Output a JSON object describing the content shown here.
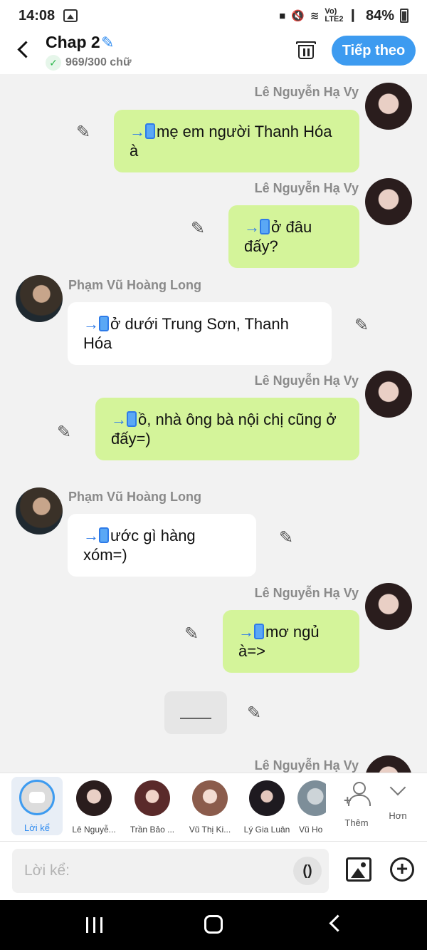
{
  "status_bar": {
    "time": "14:08",
    "network": "Vo) LTE2",
    "battery": "84%"
  },
  "header": {
    "title": "Chap 2",
    "word_count": "969/300 chữ",
    "next_label": "Tiếp theo",
    "accent_color": "#3d9bf0"
  },
  "messages": [
    {
      "sender": "Lê Nguyễn Hạ Vy",
      "text": "mẹ em người Thanh Hóa à",
      "side": "right"
    },
    {
      "sender": "Lê Nguyễn Hạ Vy",
      "text": "ở đâu đấy?",
      "side": "right"
    },
    {
      "sender": "Phạm Vũ Hoàng Long",
      "text": "ở dưới Trung Sơn, Thanh Hóa",
      "side": "left"
    },
    {
      "sender": "Lê Nguyễn Hạ Vy",
      "text": "ồ, nhà ông bà nội chị cũng ở đấy=)",
      "side": "right"
    },
    {
      "sender": "Phạm Vũ Hoàng Long",
      "text": "ước gì hàng xóm=)",
      "side": "left"
    },
    {
      "sender": "Lê Nguyễn Hạ Vy",
      "text": "mơ ngủ à=>",
      "side": "right"
    },
    {
      "sender": "Lê Nguyễn Hạ Vy",
      "text": "",
      "side": "right"
    }
  ],
  "characters": {
    "narrator": "Lời kể",
    "list": [
      "Lê Nguyễ...",
      "Trần Bảo ...",
      "Vũ Thị Ki...",
      "Lý Gia Luân",
      "Vũ Ho"
    ],
    "add_label": "Thêm",
    "more_label": "Hơn"
  },
  "composer": {
    "placeholder": "Lời kể:",
    "paren_label": "()"
  },
  "colors": {
    "my_bubble": "#d4f49a",
    "their_bubble": "#ffffff",
    "background": "#f2f2f2"
  }
}
